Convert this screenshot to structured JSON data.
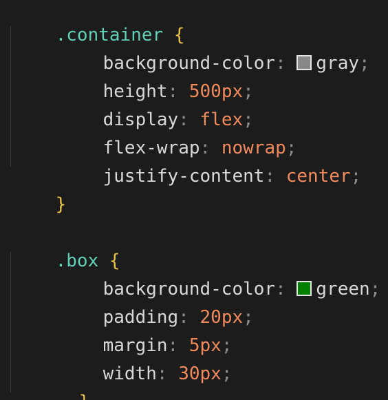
{
  "colors": {
    "background": "#1c1c1c",
    "selector": "#5fd0b5",
    "brace": "#e8c14a",
    "property": "#d8d8d8",
    "punctuation": "#8c8c8c",
    "value": "#f08a5d"
  },
  "code": {
    "container": {
      "selector": ".container",
      "open_brace": "{",
      "close_brace": "}",
      "decls": [
        {
          "prop": "background-color",
          "colon": ":",
          "swatch": "#888888",
          "value": "gray",
          "semi": ";"
        },
        {
          "prop": "height",
          "colon": ":",
          "value": "500px",
          "semi": ";"
        },
        {
          "prop": "display",
          "colon": ":",
          "value": "flex",
          "semi": ";"
        },
        {
          "prop": "flex-wrap",
          "colon": ":",
          "value": "nowrap",
          "semi": ";"
        },
        {
          "prop": "justify-content",
          "colon": ":",
          "value": "center",
          "semi": ";"
        }
      ]
    },
    "box": {
      "selector": ".box",
      "open_brace": "{",
      "close_brace": "}",
      "decls": [
        {
          "prop": "background-color",
          "colon": ":",
          "swatch": "#008000",
          "value": "green",
          "semi": ";"
        },
        {
          "prop": "padding",
          "colon": ":",
          "value": "20px",
          "semi": ";"
        },
        {
          "prop": "margin",
          "colon": ":",
          "value": "5px",
          "semi": ";"
        },
        {
          "prop": "width",
          "colon": ":",
          "value": "30px",
          "semi": ";"
        }
      ]
    }
  }
}
